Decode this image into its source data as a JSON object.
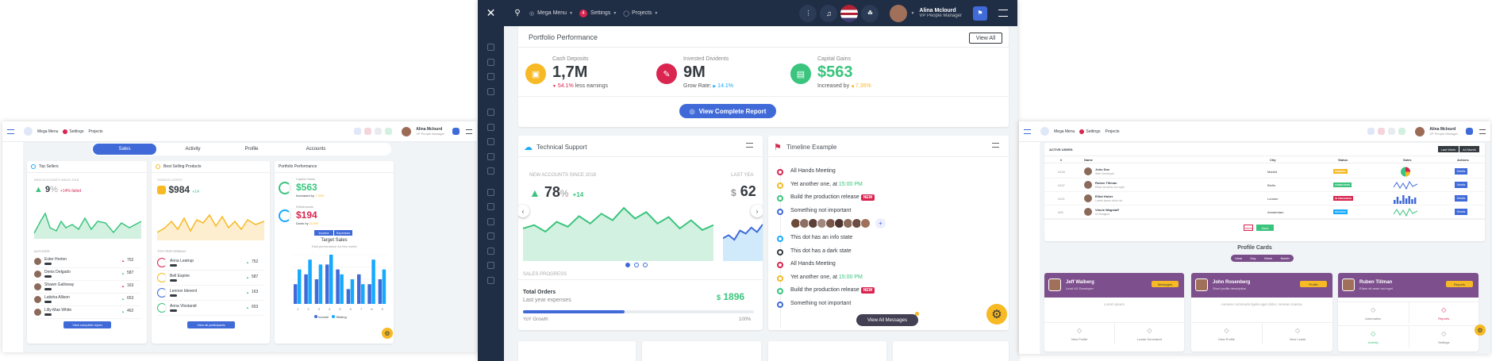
{
  "colors": {
    "primary": "#3f6ad8",
    "success": "#3ac47d",
    "danger": "#d92550",
    "warning": "#f7b924",
    "info": "#16aaff",
    "dark": "#343a40",
    "header_dark": "#1f2d45"
  },
  "center": {
    "header": {
      "mega_menu": "Mega Menu",
      "settings": "Settings",
      "settings_badge": "4",
      "projects": "Projects",
      "user_name": "Alina Mclourd",
      "user_role": "VP People Manager"
    },
    "portfolio": {
      "title": "Portfolio Performance",
      "view_all": "View All",
      "stats": [
        {
          "label": "Cash Deposits",
          "value": "1,7M",
          "delta": "54.1%",
          "sub": "less earnings"
        },
        {
          "label": "Invested Dividents",
          "value": "9M",
          "sub": "Grow Rate:",
          "delta": "14.1%"
        },
        {
          "label": "Capital Gains",
          "value": "$563",
          "sub": "Increased by",
          "delta": "7.35%"
        }
      ],
      "button": "View Complete Report"
    },
    "tech": {
      "title": "Technical Support",
      "new_accounts": "NEW ACCOUNTS SINCE 2018",
      "value": "78",
      "pct": "%",
      "delta": "+14",
      "last_year": "LAST YEA",
      "ghost_value": "62",
      "sales_progress": "SALES PROGRESS",
      "total_orders": "Total Orders",
      "last_year_expenses": "Last year expenses",
      "orders_value": "1896",
      "orders_currency": "$",
      "yoy": "YoY Growth",
      "hundred": "100%",
      "progress": 0.44
    },
    "timeline": {
      "title": "Timeline Example",
      "button": "View All Messages",
      "items": [
        {
          "text": "All Hands Meeting",
          "color": "#d92550",
          "ring": true
        },
        {
          "text": "Yet another one, at",
          "time": "15:00 PM",
          "color": "#f7b924",
          "ring": true
        },
        {
          "text": "Build the production release",
          "badge": "NEW",
          "color": "#3ac47d",
          "ring": true
        },
        {
          "text": "Something not important",
          "color": "#3f6ad8",
          "ring": true,
          "avatars": true
        },
        {
          "text": "This dot has an info state",
          "color": "#16aaff",
          "ring": false
        },
        {
          "text": "This dot has a dark state",
          "color": "#343a40",
          "ring": true
        },
        {
          "text": "All Hands Meeting",
          "color": "#d92550",
          "ring": true
        },
        {
          "text": "Yet another one, at",
          "time": "15:00 PM",
          "color": "#f7b924",
          "ring": true
        },
        {
          "text": "Build the production release",
          "badge": "NEW",
          "color": "#3ac47d",
          "ring": true
        },
        {
          "text": "Something not important",
          "color": "#3f6ad8",
          "ring": true
        }
      ]
    },
    "chart_line": [
      40,
      44,
      36,
      48,
      42,
      55,
      46,
      58,
      50,
      65,
      52,
      60,
      46,
      54,
      40,
      50,
      38,
      44
    ],
    "chart_line2": [
      30,
      34,
      28,
      40,
      36,
      44,
      38,
      48
    ]
  },
  "left": {
    "header": {
      "mega_menu": "Mega Menu",
      "settings": "Settings",
      "projects": "Projects",
      "user_name": "Alina Mclourd",
      "user_role": "VP People Manager"
    },
    "tabs": [
      "Sales",
      "Activity",
      "Profile",
      "Accounts"
    ],
    "top_sellers": {
      "title": "Top Sellers",
      "new_accounts": "NEW ACCOUNTS SINCE 2018",
      "value": "9",
      "pct": "%",
      "delta": "+14% failed",
      "authors_label": "AUTHORS",
      "authors": [
        {
          "name": "Ester Horton",
          "val": "752",
          "color": "#d92550"
        },
        {
          "name": "Denis Delgado",
          "val": "587",
          "color": "#3ac47d"
        },
        {
          "name": "Shawn Galloway",
          "val": "163",
          "color": "#d92550"
        },
        {
          "name": "Latisha Allison",
          "val": "653",
          "color": "#3ac47d"
        },
        {
          "name": "Lilly-Mae White",
          "val": "462",
          "color": "#3ac47d"
        }
      ],
      "button": "View complete report"
    },
    "best_selling": {
      "title": "Best Selling Products",
      "label": "TODAYS LATEST",
      "value": "$984",
      "delta": "+14",
      "top_label": "TOP PERFORMING",
      "items": [
        {
          "name": "Anna Leatrup",
          "val": "752"
        },
        {
          "name": "Bell Espirie",
          "val": "587"
        },
        {
          "name": "Lennox Idevent",
          "val": "163"
        },
        {
          "name": "Anna Vlostandi",
          "val": "653"
        }
      ],
      "button": "View all participants"
    },
    "portfolio": {
      "title": "Portfolio Performance",
      "stat1_label": "Capital Gains",
      "stat1_value": "$563",
      "stat1_sub": "Increased by",
      "stat1_delta": "7.35%",
      "stat2_label": "Withdrawals",
      "stat2_value": "$194",
      "stat2_sub": "Down by",
      "stat2_delta": "21.8%",
      "tab_income": "Income",
      "tab_expenses": "Expenses",
      "target_title": "Target Sales",
      "target_sub": "Total performance for this month",
      "legend": [
        "Income",
        "Striking"
      ],
      "bars": [
        [
          4,
          7
        ],
        [
          6,
          9
        ],
        [
          5,
          8
        ],
        [
          8,
          10
        ],
        [
          7,
          6
        ],
        [
          3,
          5
        ],
        [
          6,
          4
        ],
        [
          4,
          9
        ],
        [
          5,
          7
        ]
      ]
    }
  },
  "right": {
    "header": {
      "mega_menu": "Mega Menu",
      "settings": "Settings",
      "projects": "Projects",
      "user_name": "Alina Mclourd",
      "user_role": "VP People Manager"
    },
    "users": {
      "title": "ACTIVE USERS",
      "btn_last": "Last Week",
      "btn_all": "All Month",
      "cols": [
        "#",
        "Name",
        "City",
        "Status",
        "Sales",
        "Actions"
      ],
      "rows": [
        {
          "id": "#345",
          "name": "John Doe",
          "sub": "Web Developer",
          "city": "Madrid",
          "status": "PENDING",
          "scolor": "#f7b924",
          "action": "Details",
          "chart": "pie"
        },
        {
          "id": "#347",
          "name": "Ruben Tillman",
          "sub": "Etiam sit amet orci eget",
          "city": "Berlin",
          "status": "COMPLETED",
          "scolor": "#3ac47d",
          "action": "Details",
          "chart": "line"
        },
        {
          "id": "#321",
          "name": "Elliot Huber",
          "sub": "Lorem ipsum dolor sic",
          "city": "London",
          "status": "IN PROGRESS",
          "scolor": "#d92550",
          "action": "Details",
          "chart": "bar"
        },
        {
          "id": "#55",
          "name": "Vinnie Wagstaff",
          "sub": "UI Designer",
          "city": "Amsterdam",
          "status": "ON HOLD",
          "scolor": "#16aaff",
          "action": "Details",
          "chart": "line2"
        }
      ],
      "delete": "Delete",
      "save": "Save"
    },
    "profile_cards": {
      "title": "Profile Cards",
      "tabs": [
        "Ideal",
        "Day",
        "Week",
        "Month"
      ],
      "cards": [
        {
          "name": "Jeff Walberg",
          "role": "Lead UX Developer",
          "btn": "Messages",
          "btn_color": "#f7b924",
          "text": "Lorem ipsum",
          "actions": [
            "View Profile",
            "Leads Generated"
          ]
        },
        {
          "name": "John Rosenberg",
          "role": "Short profile description",
          "btn": "Profile",
          "btn_color": "#f7b924",
          "text": "Aenean commodo ligula eget dolor. Aenean massa.",
          "actions": [
            "View Profile",
            "View Leads"
          ]
        },
        {
          "name": "Ruben Tillman",
          "role": "Etiam sit amet orci eget",
          "btn": "Reports",
          "btn_color": "#f7b924",
          "text": "",
          "actions": [
            "Automation",
            "Reports",
            "Activity",
            "Settings"
          ]
        }
      ]
    }
  }
}
